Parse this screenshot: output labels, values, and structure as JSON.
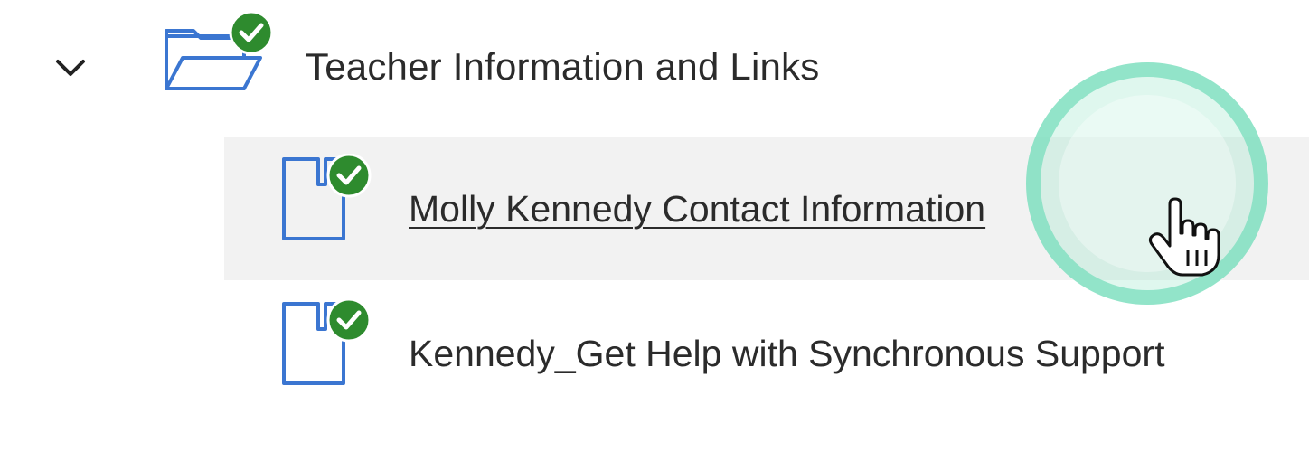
{
  "folder": {
    "title": "Teacher Information and Links",
    "expanded": true,
    "completed": true,
    "icon": "folder-open-icon"
  },
  "items": [
    {
      "label": "Molly Kennedy Contact Information",
      "completed": true,
      "hovered": true,
      "icon": "document-icon"
    },
    {
      "label": "Kennedy_Get Help with Synchronous Support",
      "completed": true,
      "hovered": false,
      "icon": "document-icon"
    }
  ],
  "colors": {
    "icon_blue": "#3b76d1",
    "check_green": "#2e8b2e",
    "hover_bg": "#f2f2f2",
    "click_ring": "#7fe0c0",
    "text": "#2b2b2b"
  }
}
